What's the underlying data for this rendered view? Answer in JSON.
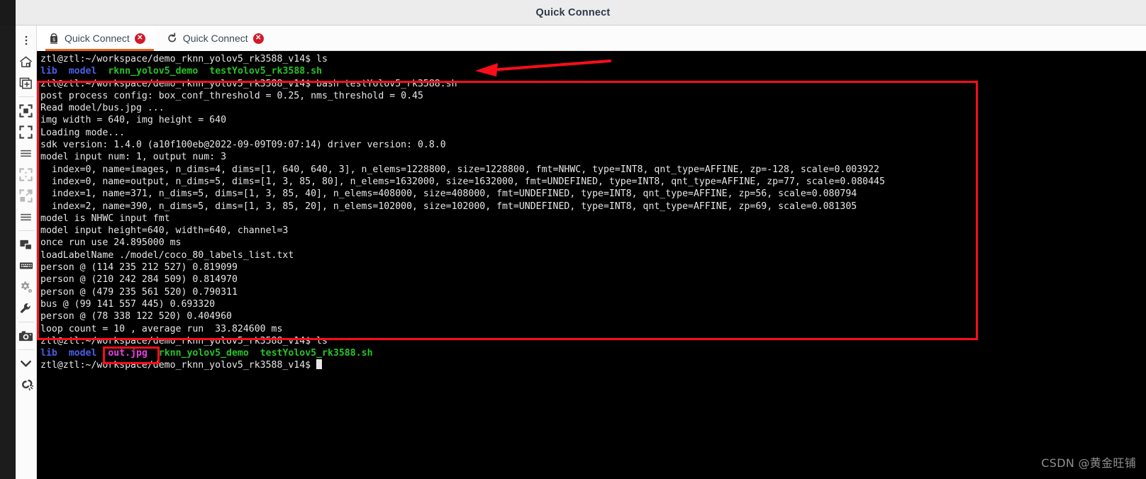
{
  "window": {
    "title": "Quick Connect"
  },
  "sidebar": {
    "items": [
      {
        "name": "more-options-icon",
        "label": "More options"
      },
      {
        "name": "home-icon",
        "label": "Home"
      },
      {
        "name": "new-tab-icon",
        "label": "New tab"
      },
      {
        "name": "focus-mode-icon",
        "label": "Focus mode"
      },
      {
        "name": "fullscreen-icon",
        "label": "Full screen"
      },
      {
        "name": "list-view-icon",
        "label": "List view"
      },
      {
        "name": "resize-icon",
        "label": "Resize"
      },
      {
        "name": "expand-icon",
        "label": "Expand"
      },
      {
        "name": "menu-icon",
        "label": "Menu"
      },
      {
        "name": "split-view-icon",
        "label": "Split view"
      },
      {
        "name": "keyboard-icon",
        "label": "Keyboard"
      },
      {
        "name": "settings-gear-icon",
        "label": "Settings"
      },
      {
        "name": "wrench-icon",
        "label": "Tools"
      },
      {
        "name": "camera-icon",
        "label": "Screenshot"
      },
      {
        "name": "chevron-down-icon",
        "label": "Collapse"
      },
      {
        "name": "link-broken-icon",
        "label": "Disconnect"
      }
    ]
  },
  "tabs": [
    {
      "label": "Quick Connect",
      "icon": "terminal-lock-icon",
      "active": true,
      "close": "✕"
    },
    {
      "label": "Quick Connect",
      "icon": "reconnect-icon",
      "active": false,
      "close": "✕"
    }
  ],
  "terminal": {
    "prompt": "ztl@ztl:~/workspace/demo_rknn_yolov5_rk3588_v14$",
    "lines": [
      {
        "id": "l01",
        "type": "prompt",
        "command": " ls"
      },
      {
        "id": "l02",
        "type": "ls",
        "entries": [
          {
            "text": "lib",
            "color": "blue"
          },
          {
            "text": "model",
            "color": "blue"
          },
          {
            "text": "rknn_yolov5_demo",
            "color": "green"
          },
          {
            "text": "testYolov5_rk3588.sh",
            "color": "green"
          }
        ]
      },
      {
        "id": "l03",
        "type": "prompt",
        "command": " bash testYolov5_rk3588.sh"
      },
      {
        "id": "l04",
        "type": "out",
        "text": "post process config: box_conf_threshold = 0.25, nms_threshold = 0.45"
      },
      {
        "id": "l05",
        "type": "out",
        "text": "Read model/bus.jpg ..."
      },
      {
        "id": "l06",
        "type": "out",
        "text": "img width = 640, img height = 640"
      },
      {
        "id": "l07",
        "type": "out",
        "text": "Loading mode..."
      },
      {
        "id": "l08",
        "type": "out",
        "text": "sdk version: 1.4.0 (a10f100eb@2022-09-09T09:07:14) driver version: 0.8.0"
      },
      {
        "id": "l09",
        "type": "out",
        "text": "model input num: 1, output num: 3"
      },
      {
        "id": "l10",
        "type": "out",
        "text": "  index=0, name=images, n_dims=4, dims=[1, 640, 640, 3], n_elems=1228800, size=1228800, fmt=NHWC, type=INT8, qnt_type=AFFINE, zp=-128, scale=0.003922"
      },
      {
        "id": "l11",
        "type": "out",
        "text": "  index=0, name=output, n_dims=5, dims=[1, 3, 85, 80], n_elems=1632000, size=1632000, fmt=UNDEFINED, type=INT8, qnt_type=AFFINE, zp=77, scale=0.080445"
      },
      {
        "id": "l12",
        "type": "out",
        "text": "  index=1, name=371, n_dims=5, dims=[1, 3, 85, 40], n_elems=408000, size=408000, fmt=UNDEFINED, type=INT8, qnt_type=AFFINE, zp=56, scale=0.080794"
      },
      {
        "id": "l13",
        "type": "out",
        "text": "  index=2, name=390, n_dims=5, dims=[1, 3, 85, 20], n_elems=102000, size=102000, fmt=UNDEFINED, type=INT8, qnt_type=AFFINE, zp=69, scale=0.081305"
      },
      {
        "id": "l14",
        "type": "out",
        "text": "model is NHWC input fmt"
      },
      {
        "id": "l15",
        "type": "out",
        "text": "model input height=640, width=640, channel=3"
      },
      {
        "id": "l16",
        "type": "out",
        "text": "once run use 24.895000 ms"
      },
      {
        "id": "l17",
        "type": "out",
        "text": "loadLabelName ./model/coco_80_labels_list.txt"
      },
      {
        "id": "l18",
        "type": "out",
        "text": "person @ (114 235 212 527) 0.819099"
      },
      {
        "id": "l19",
        "type": "out",
        "text": "person @ (210 242 284 509) 0.814970"
      },
      {
        "id": "l20",
        "type": "out",
        "text": "person @ (479 235 561 520) 0.790311"
      },
      {
        "id": "l21",
        "type": "out",
        "text": "bus @ (99 141 557 445) 0.693320"
      },
      {
        "id": "l22",
        "type": "out",
        "text": "person @ (78 338 122 520) 0.404960"
      },
      {
        "id": "l23",
        "type": "out",
        "text": "loop count = 10 , average run  33.824600 ms"
      },
      {
        "id": "l24",
        "type": "prompt",
        "command": " ls"
      },
      {
        "id": "l25",
        "type": "ls",
        "entries": [
          {
            "text": "lib",
            "color": "blue"
          },
          {
            "text": "model",
            "color": "blue"
          },
          {
            "text": "out.jpg",
            "color": "magenta"
          },
          {
            "text": "rknn_yolov5_demo",
            "color": "green"
          },
          {
            "text": "testYolov5_rk3588.sh",
            "color": "green"
          }
        ]
      },
      {
        "id": "l26",
        "type": "prompt-cursor",
        "command": " "
      }
    ]
  },
  "annotations": {
    "highlight_color": "#fc0d1b",
    "main_box_label": "inference-output-highlight",
    "outjpg_box_label": "out-jpg-highlight",
    "arrow_label": "points-to-script-name"
  },
  "watermark": {
    "text": "CSDN @黄金旺铺"
  },
  "colors": {
    "terminal_bg": "#000000",
    "terminal_fg": "#e6e6e6",
    "dir_blue": "#4a5fe8",
    "exec_green": "#27c427",
    "image_magenta": "#e83fe8",
    "tab_accent": "#e8621a",
    "close_red": "#d11a2a",
    "annotation_red": "#fc0d1b"
  }
}
